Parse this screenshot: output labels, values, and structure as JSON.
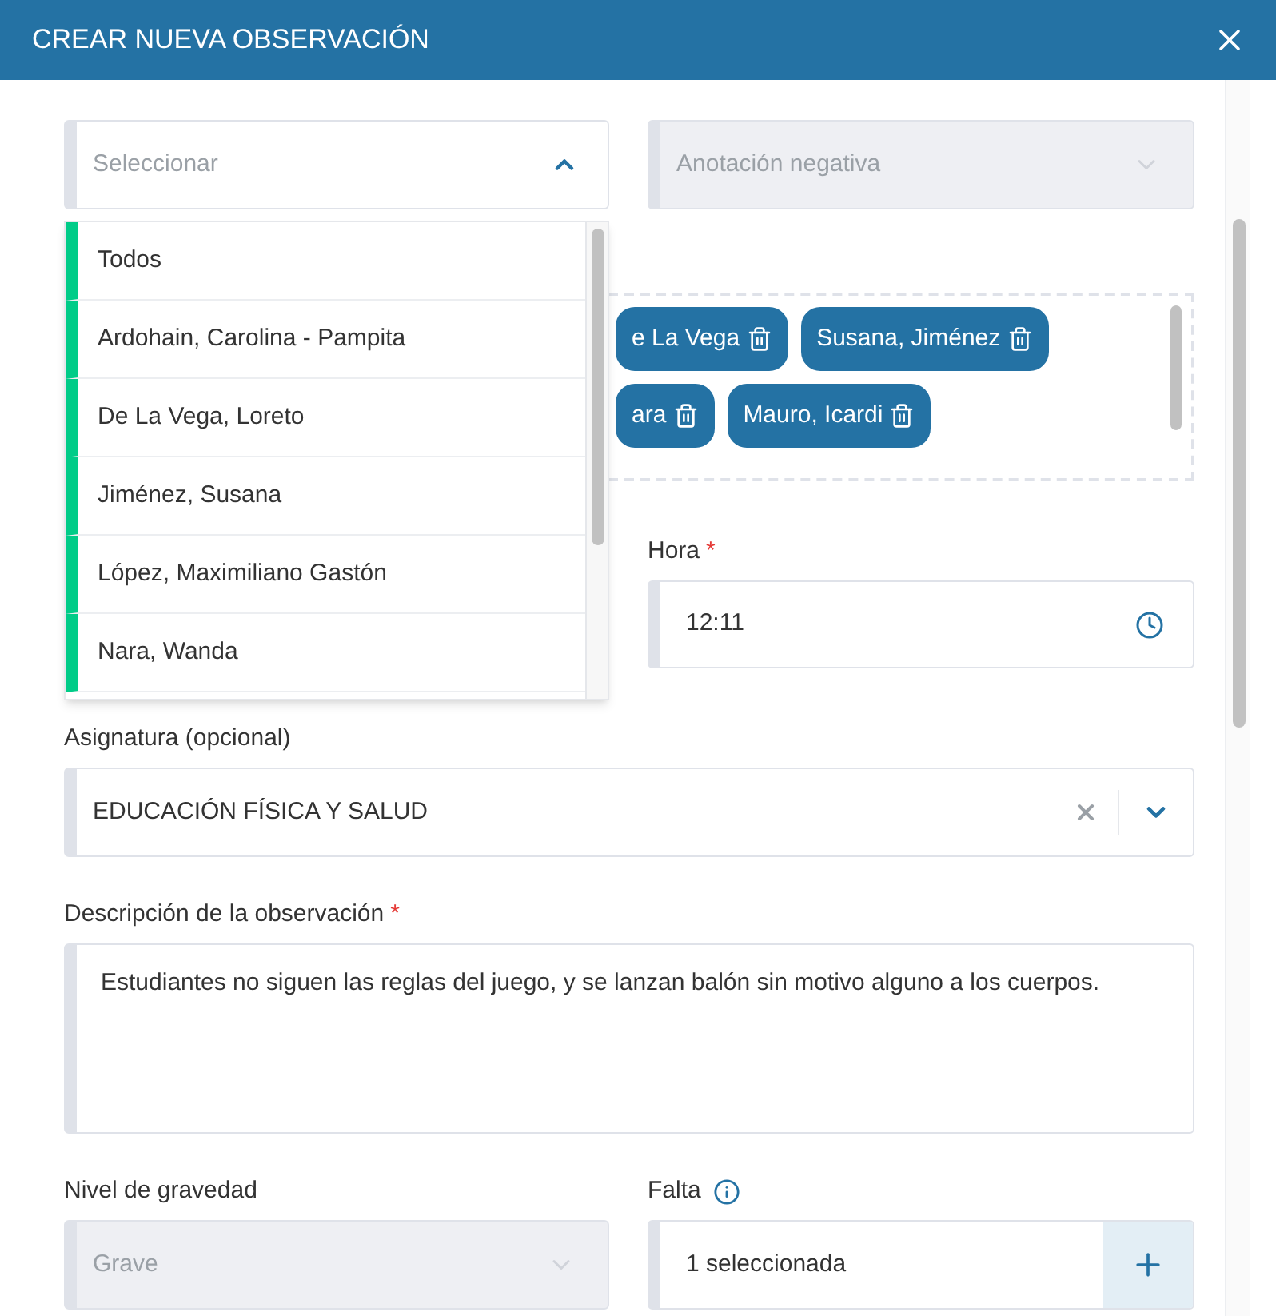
{
  "dialog": {
    "title": "CREAR NUEVA OBSERVACIÓN"
  },
  "student_select": {
    "placeholder": "Seleccionar",
    "expanded": true,
    "options": [
      {
        "label": "Todos"
      },
      {
        "label": "Ardohain, Carolina - Pampita"
      },
      {
        "label": "De La Vega, Loreto"
      },
      {
        "label": "Jiménez, Susana"
      },
      {
        "label": "López, Maximiliano Gastón"
      },
      {
        "label": "Nara, Wanda"
      }
    ]
  },
  "type_select": {
    "value": "Anotación negativa",
    "disabled": true
  },
  "selected_students": [
    {
      "label": "e La Vega"
    },
    {
      "label": "Susana, Jiménez"
    },
    {
      "label": "ara"
    },
    {
      "label": "Mauro, Icardi"
    }
  ],
  "time": {
    "label": "Hora",
    "required": true,
    "required_mark": "*",
    "value": "12:11"
  },
  "subject": {
    "label": "Asignatura (opcional)",
    "value": "EDUCACIÓN FÍSICA Y SALUD"
  },
  "description": {
    "label": "Descripción de la observación",
    "required": true,
    "required_mark": "*",
    "value": "Estudiantes no siguen las reglas del juego, y se lanzan balón sin motivo alguno a los cuerpos."
  },
  "severity": {
    "label": "Nivel de gravedad",
    "value": "Grave",
    "disabled": true
  },
  "fault": {
    "label": "Falta",
    "value": "1 seleccionada"
  }
}
